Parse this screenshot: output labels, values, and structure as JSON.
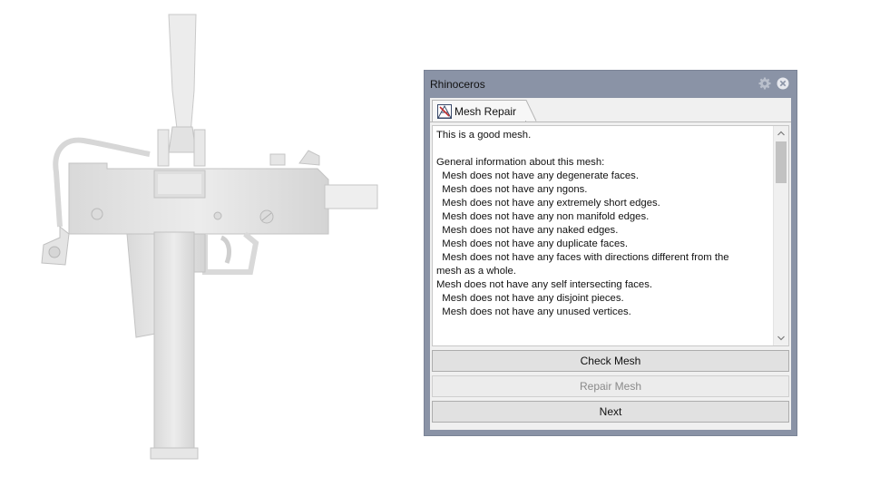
{
  "dialog": {
    "title": "Rhinoceros",
    "tab_label": "Mesh Repair",
    "report_text": "This is a good mesh.\n\nGeneral information about this mesh:\n  Mesh does not have any degenerate faces.\n  Mesh does not have any ngons.\n  Mesh does not have any extremely short edges.\n  Mesh does not have any non manifold edges.\n  Mesh does not have any naked edges.\n  Mesh does not have any duplicate faces.\n  Mesh does not have any faces with directions different from the\nmesh as a whole.\nMesh does not have any self intersecting faces.\n  Mesh does not have any disjoint pieces.\n  Mesh does not have any unused vertices.",
    "buttons": {
      "check": "Check Mesh",
      "repair": "Repair Mesh",
      "next": "Next"
    },
    "icons": {
      "settings": "gear-icon",
      "close": "close-icon",
      "tab": "mesh-repair-icon",
      "scroll_up": "chevron-up-icon",
      "scroll_down": "chevron-down-icon"
    }
  },
  "viewport": {
    "model": "submachine-gun-mesh"
  }
}
